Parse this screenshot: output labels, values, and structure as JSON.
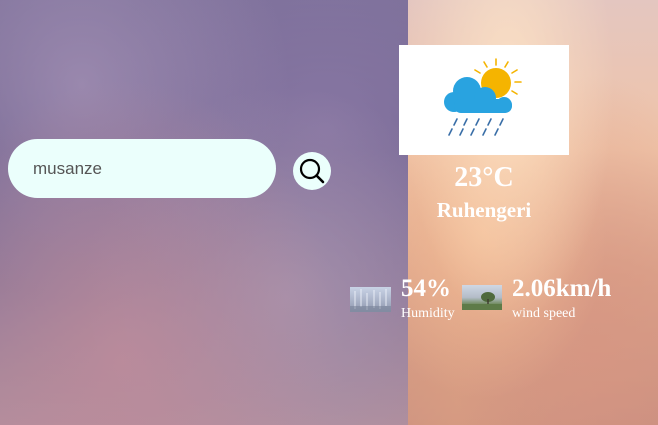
{
  "search": {
    "value": "musanze",
    "icon": "search-icon"
  },
  "weather": {
    "icon": "rain-sun-cloud-icon",
    "temperature": "23°C",
    "city": "Ruhengeri"
  },
  "humidity": {
    "value": "54%",
    "label": "Humidity",
    "image": "humidity-image"
  },
  "wind": {
    "value": "2.06km/h",
    "label": "wind speed",
    "image": "wind-image"
  },
  "colors": {
    "search_background": "#ebfffc",
    "text_light": "#ffffff",
    "sun": "#f5b400",
    "cloud": "#29a3e0",
    "rain": "#3a6fa8"
  }
}
